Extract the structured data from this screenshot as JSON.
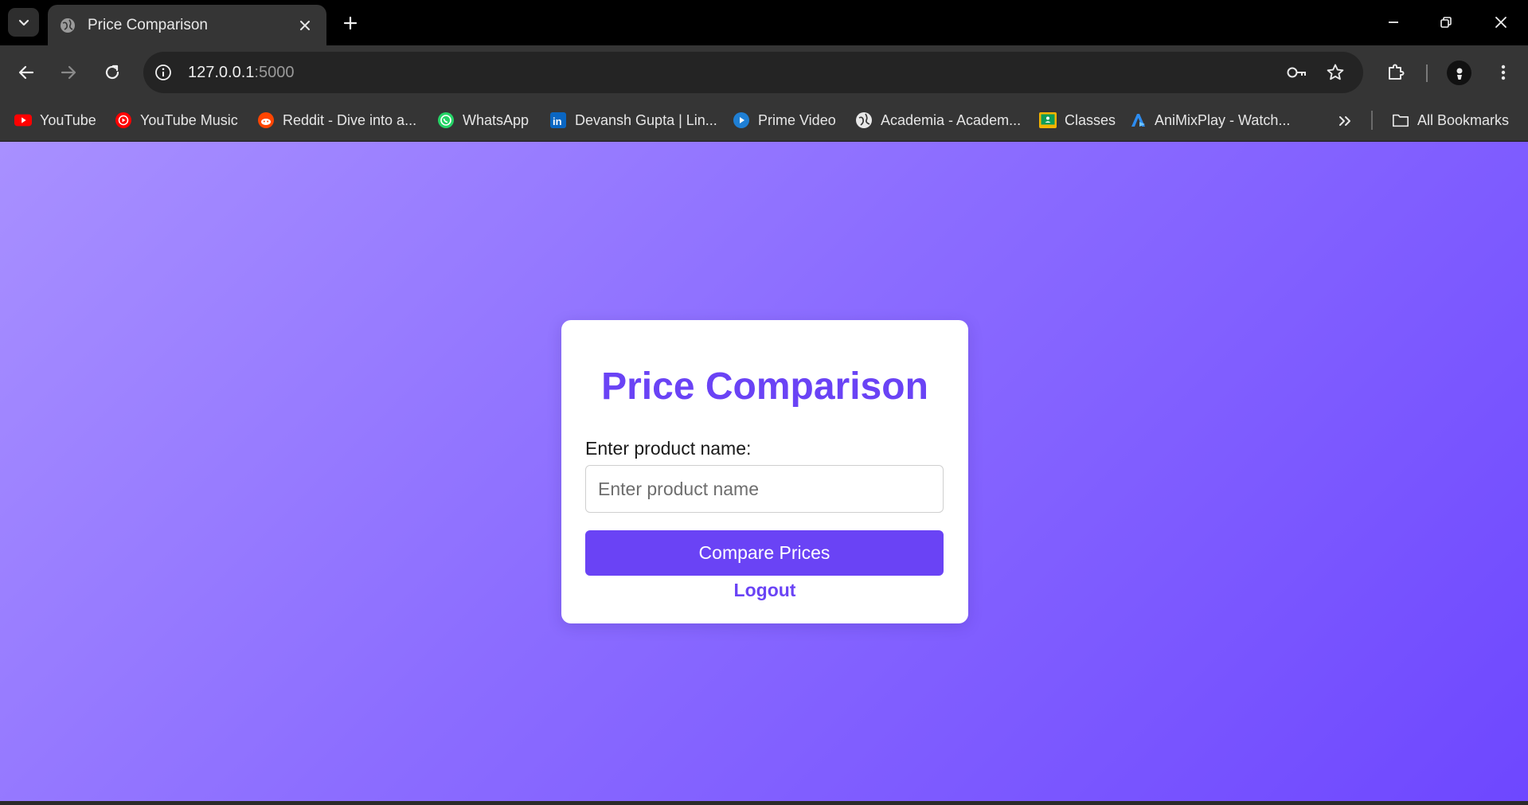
{
  "browser": {
    "tab": {
      "title": "Price Comparison",
      "favicon": "globe-icon"
    },
    "url": {
      "host": "127.0.0.1",
      "port": ":5000"
    },
    "bookmarks": [
      {
        "label": "YouTube",
        "icon": "youtube-icon"
      },
      {
        "label": "YouTube Music",
        "icon": "youtube-music-icon"
      },
      {
        "label": "Reddit - Dive into a...",
        "icon": "reddit-icon"
      },
      {
        "label": "WhatsApp",
        "icon": "whatsapp-icon"
      },
      {
        "label": "Devansh Gupta | Lin...",
        "icon": "linkedin-icon"
      },
      {
        "label": "Prime Video",
        "icon": "prime-video-icon"
      },
      {
        "label": "Academia - Academ...",
        "icon": "globe-icon"
      },
      {
        "label": "Classes",
        "icon": "classroom-icon"
      },
      {
        "label": "AniMixPlay - Watch...",
        "icon": "animixplay-icon"
      }
    ],
    "all_bookmarks": "All Bookmarks"
  },
  "page": {
    "title": "Price Comparison",
    "product_label": "Enter product name:",
    "product_placeholder": "Enter product name",
    "compare_button": "Compare Prices",
    "logout_link": "Logout"
  },
  "colors": {
    "accent": "#6a43f5",
    "gradient_start": "#a890ff",
    "gradient_end": "#6e47ff"
  }
}
